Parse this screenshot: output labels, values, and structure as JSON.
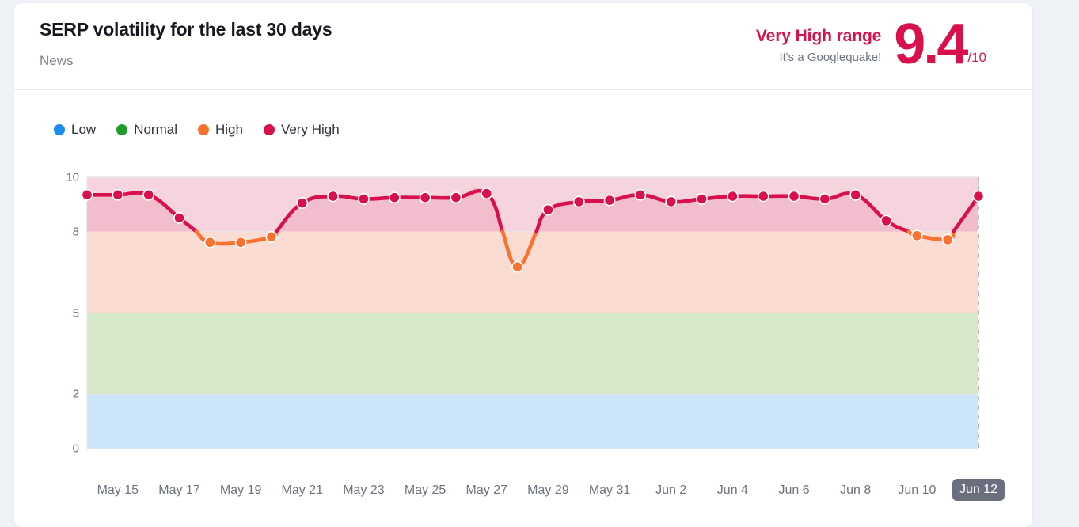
{
  "header": {
    "title": "SERP volatility for the last 30 days",
    "subtitle": "News",
    "score_range": "Very High range",
    "score_quip": "It's a Googlequake!",
    "score_value": "9.4",
    "score_denominator": "/10"
  },
  "legend": {
    "items": [
      {
        "label": "Low",
        "color": "#1a8cf0"
      },
      {
        "label": "Normal",
        "color": "#1f9c2a"
      },
      {
        "label": "High",
        "color": "#fa7130"
      },
      {
        "label": "Very High",
        "color": "#d8114c"
      }
    ]
  },
  "colors": {
    "page_background": "#eef1f6",
    "card_background": "#ffffff",
    "accent": "#d8114c",
    "high": "#fa7130",
    "band_very_high": "#f6d4de",
    "band_high": "#fbdcd2",
    "band_normal": "#d8e8cb",
    "band_low": "#cce5f9",
    "grid": "#e4e6ea",
    "axis_text": "#6e7380",
    "current_badge": "#6b6f7d"
  },
  "chart_data": {
    "type": "line",
    "title": "SERP volatility for the last 30 days",
    "xlabel": "",
    "ylabel": "",
    "ylim": [
      0,
      10
    ],
    "yticks": [
      0,
      2,
      5,
      8,
      10
    ],
    "grid": true,
    "legend_position": "top-left",
    "current_marker": "Jun 12",
    "bands": [
      {
        "name": "Low",
        "from": 0,
        "to": 2,
        "color": "#cce5f9"
      },
      {
        "name": "Normal",
        "from": 2,
        "to": 5,
        "color": "#d8e8cb"
      },
      {
        "name": "High",
        "from": 5,
        "to": 8,
        "color": "#fbdcd2"
      },
      {
        "name": "Very High",
        "from": 8,
        "to": 10,
        "color": "#f6d4de"
      }
    ],
    "xtick_labels": [
      "May 15",
      "May 17",
      "May 19",
      "May 21",
      "May 23",
      "May 25",
      "May 27",
      "May 29",
      "May 31",
      "Jun 2",
      "Jun 4",
      "Jun 6",
      "Jun 8",
      "Jun 10",
      "Jun 12"
    ],
    "x": [
      "May 14",
      "May 15",
      "May 16",
      "May 17",
      "May 18",
      "May 19",
      "May 20",
      "May 21",
      "May 22",
      "May 23",
      "May 24",
      "May 25",
      "May 26",
      "May 27",
      "May 28",
      "May 29",
      "May 30",
      "May 31",
      "Jun 1",
      "Jun 2",
      "Jun 3",
      "Jun 4",
      "Jun 5",
      "Jun 6",
      "Jun 7",
      "Jun 8",
      "Jun 9",
      "Jun 10",
      "Jun 11",
      "Jun 12"
    ],
    "values": [
      9.35,
      9.35,
      9.35,
      8.5,
      7.6,
      7.6,
      7.8,
      9.05,
      9.3,
      9.2,
      9.25,
      9.25,
      9.25,
      9.4,
      6.7,
      8.8,
      9.1,
      9.15,
      9.35,
      9.1,
      9.2,
      9.3,
      9.3,
      9.3,
      9.2,
      9.35,
      8.4,
      7.85,
      7.7,
      9.3
    ]
  }
}
